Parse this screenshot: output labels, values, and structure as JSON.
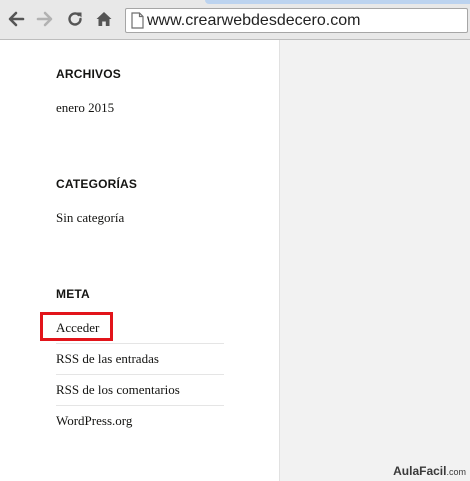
{
  "browser": {
    "address": "www.crearwebdesdecero.com",
    "icons": [
      "back-arrow-icon",
      "forward-arrow-icon",
      "reload-icon",
      "home-icon",
      "page-icon"
    ]
  },
  "sidebar": {
    "archives": {
      "title": "ARCHIVOS",
      "items": [
        "enero 2015"
      ]
    },
    "categories": {
      "title": "CATEGORÍAS",
      "items": [
        "Sin categoría"
      ]
    },
    "meta": {
      "title": "META",
      "items": [
        "Acceder",
        "RSS de las entradas",
        "RSS de los comentarios",
        "WordPress.org"
      ]
    }
  },
  "annotation": {
    "highlighted_item": "Acceder",
    "color": "#e2141a"
  },
  "watermark": {
    "brand": "AulaFacil",
    "suffix": ".com"
  }
}
